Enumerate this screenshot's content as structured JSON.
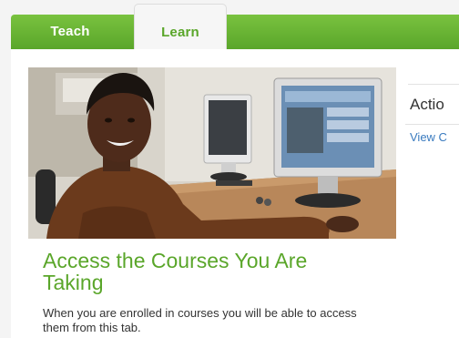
{
  "nav": {
    "tabs": [
      {
        "label": "Teach"
      },
      {
        "label": "Learn"
      }
    ]
  },
  "main": {
    "headline": "Access the Courses You Are Taking",
    "description": "When you are enrolled in courses you will be able to access them from this tab."
  },
  "sidebar": {
    "title": "Actio",
    "link": "View C"
  },
  "colors": {
    "brand_green": "#5aa62a",
    "link_blue": "#3a7bbf"
  },
  "icons": {
    "hero": "student-at-computer-photo"
  }
}
